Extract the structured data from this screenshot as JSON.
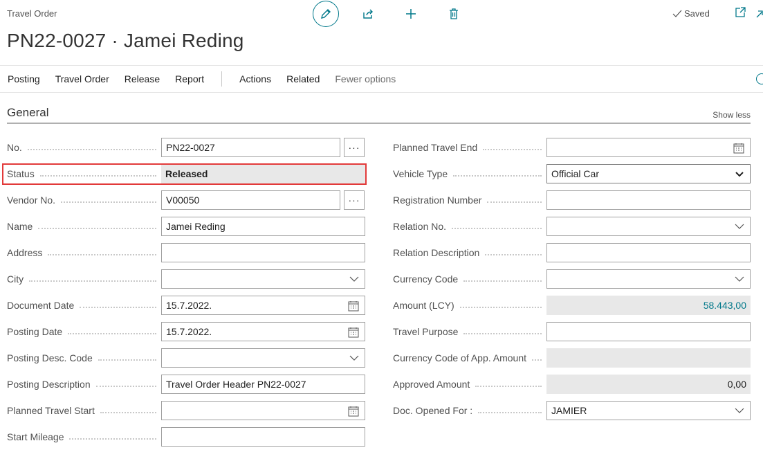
{
  "header": {
    "page_kind": "Travel Order",
    "title": "PN22-0027 · Jamei Reding",
    "saved_label": "Saved"
  },
  "icons": {
    "edit": "pencil-icon",
    "share": "share-icon",
    "new": "plus-icon",
    "delete": "trash-icon",
    "popout": "popout-icon",
    "collapse": "collapse-icon"
  },
  "action_bar": {
    "items": [
      "Posting",
      "Travel Order",
      "Release",
      "Report"
    ],
    "items_after": [
      "Actions",
      "Related"
    ],
    "fewer_options": "Fewer options"
  },
  "section": {
    "title": "General",
    "show_less": "Show less"
  },
  "left_fields": [
    {
      "label": "No.",
      "value": "PN22-0027"
    },
    {
      "label": "Status",
      "value": "Released"
    },
    {
      "label": "Vendor No.",
      "value": "V00050"
    },
    {
      "label": "Name",
      "value": "Jamei Reding"
    },
    {
      "label": "Address",
      "value": ""
    },
    {
      "label": "City",
      "value": ""
    },
    {
      "label": "Document Date",
      "value": "15.7.2022."
    },
    {
      "label": "Posting Date",
      "value": "15.7.2022."
    },
    {
      "label": "Posting Desc. Code",
      "value": ""
    },
    {
      "label": "Posting Description",
      "value": "Travel Order Header PN22-0027"
    },
    {
      "label": "Planned Travel Start",
      "value": ""
    },
    {
      "label": "Start Mileage",
      "value": ""
    }
  ],
  "right_fields": [
    {
      "label": "Planned Travel End",
      "value": ""
    },
    {
      "label": "Vehicle Type",
      "value": "Official Car"
    },
    {
      "label": "Registration Number",
      "value": ""
    },
    {
      "label": "Relation No.",
      "value": ""
    },
    {
      "label": "Relation Description",
      "value": ""
    },
    {
      "label": "Currency Code",
      "value": ""
    },
    {
      "label": "Amount (LCY)",
      "value": "58.443,00"
    },
    {
      "label": "Travel Purpose",
      "value": ""
    },
    {
      "label": "Currency Code of App. Amount",
      "value": ""
    },
    {
      "label": "Approved Amount",
      "value": "0,00"
    },
    {
      "label": "Doc. Opened For :",
      "value": "JAMIER"
    }
  ],
  "ellipsis_label": "···",
  "colors": {
    "accent": "#00788a",
    "highlight": "#e23a3a",
    "readonly_bg": "#e8e8e8"
  }
}
